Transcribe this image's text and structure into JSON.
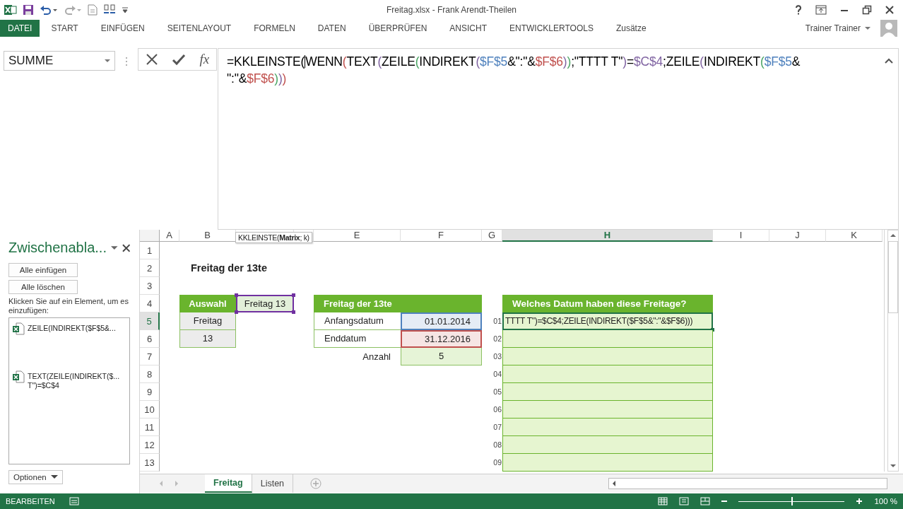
{
  "window": {
    "title": "Freitag.xlsx - Frank Arendt-Theilen"
  },
  "ribbon": {
    "tabs": [
      {
        "label": "DATEI",
        "selected": true
      },
      {
        "label": "START",
        "selected": false
      },
      {
        "label": "EINFÜGEN",
        "selected": false
      },
      {
        "label": "SEITENLAYOUT",
        "selected": false
      },
      {
        "label": "FORMELN",
        "selected": false
      },
      {
        "label": "DATEN",
        "selected": false
      },
      {
        "label": "ÜBERPRÜFEN",
        "selected": false
      },
      {
        "label": "ANSICHT",
        "selected": false
      },
      {
        "label": "ENTWICKLERTOOLS",
        "selected": false
      },
      {
        "label": "Zusätze",
        "selected": false
      }
    ],
    "user": "Trainer Trainer"
  },
  "formula_bar": {
    "name_box": "SUMME",
    "fx": "fx",
    "lines": [
      [
        {
          "text": "=KKLEINSTE(",
          "color": "#000000"
        },
        {
          "caret": true,
          "text": "WENN",
          "color": "#000000"
        },
        {
          "text": "(",
          "color": "#c0504d"
        },
        {
          "text": "TEXT",
          "color": "#000000"
        },
        {
          "text": "(",
          "color": "#8064a2"
        },
        {
          "text": "ZEILE",
          "color": "#000000"
        },
        {
          "text": "(",
          "color": "#4aa564"
        },
        {
          "text": "INDIREKT",
          "color": "#000000"
        },
        {
          "text": "(",
          "color": "#8064a2"
        },
        {
          "text": "$F$5",
          "color": "#4f81bd"
        },
        {
          "text": "&\":\"&",
          "color": "#000000"
        },
        {
          "text": "$F$6",
          "color": "#c0504d"
        },
        {
          "text": ")",
          "color": "#8064a2"
        },
        {
          "text": ")",
          "color": "#4aa564"
        },
        {
          "text": ";\"TTTT T\"",
          "color": "#000000"
        },
        {
          "text": ")",
          "color": "#8064a2"
        },
        {
          "text": "=",
          "color": "#000000"
        },
        {
          "text": "$C$4",
          "color": "#8064a2"
        },
        {
          "text": ";ZEILE",
          "color": "#000000"
        },
        {
          "text": "(",
          "color": "#8064a2"
        },
        {
          "text": "INDIREKT",
          "color": "#000000"
        },
        {
          "text": "(",
          "color": "#4aa564"
        },
        {
          "text": "$F$5",
          "color": "#4f81bd"
        },
        {
          "text": "&",
          "color": "#000000"
        }
      ],
      [
        {
          "text": "\":\"&",
          "color": "#000000"
        },
        {
          "text": "$F$6",
          "color": "#c0504d"
        },
        {
          "text": ")",
          "color": "#4aa564"
        },
        {
          "text": ")",
          "color": "#8064a2"
        },
        {
          "text": ")",
          "color": "#c0504d"
        }
      ]
    ]
  },
  "clipboard_pane": {
    "title": "Zwischenabla...",
    "buttons": [
      "Alle einfügen",
      "Alle löschen"
    ],
    "hint": "Klicken Sie auf ein Element, um es einzufügen:",
    "items": [
      {
        "lines": [
          "ZEILE(INDIREKT($F$5&..."
        ]
      },
      {
        "lines": [
          "TEXT(ZEILE(INDIREKT($...",
          "T\")=$C$4"
        ]
      }
    ],
    "options": "Optionen"
  },
  "sheet": {
    "columns": [
      {
        "label": "A",
        "selected": false
      },
      {
        "label": "B",
        "selected": false
      },
      {
        "selected": false
      },
      {
        "selected": false
      },
      {
        "label": "E",
        "selected": false
      },
      {
        "label": "F",
        "selected": false
      },
      {
        "label": "G",
        "selected": false
      },
      {
        "label": "H",
        "selected": true
      },
      {
        "label": "I",
        "selected": false
      },
      {
        "label": "J",
        "selected": false
      },
      {
        "label": "K",
        "selected": false
      }
    ],
    "rows": [
      {
        "label": "1",
        "selected": false
      },
      {
        "label": "2",
        "selected": false
      },
      {
        "label": "3",
        "selected": false
      },
      {
        "label": "4",
        "selected": false
      },
      {
        "label": "5",
        "selected": true
      },
      {
        "label": "6",
        "selected": false
      },
      {
        "label": "7",
        "selected": false
      },
      {
        "label": "8",
        "selected": false
      },
      {
        "label": "9",
        "selected": false
      },
      {
        "label": "10",
        "selected": false
      },
      {
        "label": "11",
        "selected": false
      },
      {
        "label": "12",
        "selected": false
      },
      {
        "label": "13",
        "selected": false
      }
    ],
    "tooltip": "KKLEINSTE(**Matrix**; k)",
    "title": "Freitag der 13te",
    "selection": {
      "header": "Auswahl",
      "value": "Freitag 13",
      "options": [
        "Freitag",
        "13"
      ]
    },
    "friday_table": {
      "header": "Freitag der 13te",
      "rows": [
        {
          "label": "Anfangsdatum",
          "value": "01.01.2014",
          "color": "#4f81bd"
        },
        {
          "label": "Enddatum",
          "value": "31.12.2016",
          "color": "#c0504d"
        }
      ],
      "count_label": "Anzahl",
      "count": "5"
    },
    "result_table": {
      "header": "Welches Datum haben diese Freitage?",
      "rows": [
        {
          "number": "01",
          "value": "TTTT T\")=$C$4;ZEILE(INDIREKT($F$5&\":\"&$F$6)))",
          "active": true
        },
        {
          "number": "02",
          "active": false
        },
        {
          "number": "03",
          "active": false
        },
        {
          "number": "04",
          "active": false
        },
        {
          "number": "05",
          "active": false
        },
        {
          "number": "06",
          "active": false
        },
        {
          "number": "07",
          "active": false
        },
        {
          "number": "08",
          "active": false
        },
        {
          "number": "09",
          "active": false
        }
      ]
    },
    "sheet_tabs": [
      {
        "label": "Freitag",
        "selected": true
      },
      {
        "label": "Listen",
        "selected": false
      }
    ]
  },
  "status_bar": {
    "mode": "BEARBEITEN",
    "zoom": {
      "level": 0.5,
      "reading": "100 %"
    }
  }
}
